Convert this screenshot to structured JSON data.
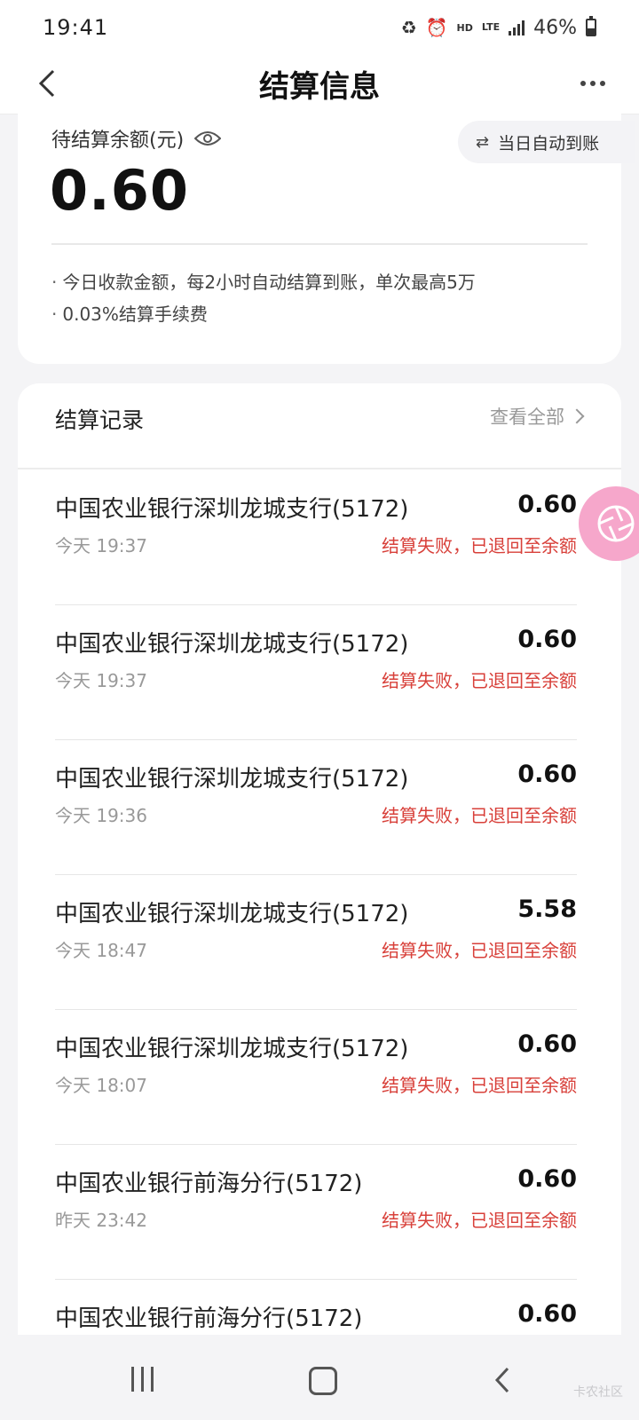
{
  "status_bar": {
    "time": "19:41",
    "battery": "46%",
    "hd": "HD",
    "lte": "LTE"
  },
  "header": {
    "title": "结算信息"
  },
  "balance_card": {
    "label": "待结算余额(元)",
    "amount": "0.60",
    "auto_button": "当日自动到账",
    "notes": [
      "今日收款金额，每2小时自动结算到账，单次最高5万",
      "0.03%结算手续费"
    ]
  },
  "records": {
    "title": "结算记录",
    "view_all": "查看全部",
    "items": [
      {
        "bank": "中国农业银行深圳龙城支行(5172)",
        "amount": "0.60",
        "time": "今天 19:37",
        "status": "结算失败，已退回至余额"
      },
      {
        "bank": "中国农业银行深圳龙城支行(5172)",
        "amount": "0.60",
        "time": "今天 19:37",
        "status": "结算失败，已退回至余额"
      },
      {
        "bank": "中国农业银行深圳龙城支行(5172)",
        "amount": "0.60",
        "time": "今天 19:36",
        "status": "结算失败，已退回至余额"
      },
      {
        "bank": "中国农业银行深圳龙城支行(5172)",
        "amount": "5.58",
        "time": "今天 18:47",
        "status": "结算失败，已退回至余额"
      },
      {
        "bank": "中国农业银行深圳龙城支行(5172)",
        "amount": "0.60",
        "time": "今天 18:07",
        "status": "结算失败，已退回至余额"
      },
      {
        "bank": "中国农业银行前海分行(5172)",
        "amount": "0.60",
        "time": "昨天 23:42",
        "status": "结算失败，已退回至余额"
      },
      {
        "bank": "中国农业银行前海分行(5172)",
        "amount": "0.60",
        "time": "",
        "status": ""
      }
    ]
  },
  "watermark": "卡农社区",
  "colors": {
    "failure": "#d8403a",
    "fab": "#f6a7cb"
  }
}
